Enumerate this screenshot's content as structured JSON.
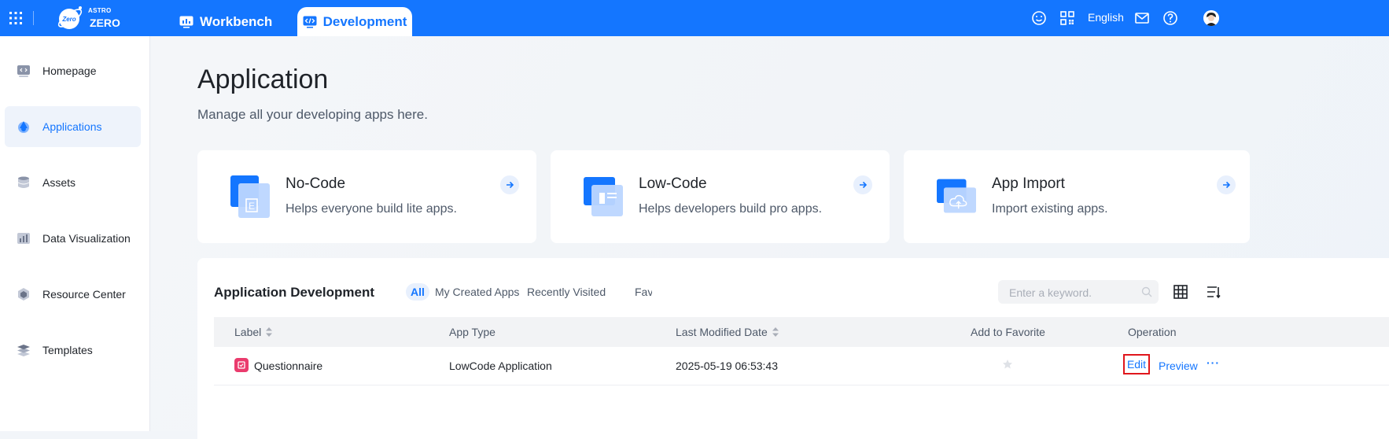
{
  "brand": {
    "line1": "ASTRO",
    "line2": "ZERO",
    "badge": "Zero"
  },
  "topbar": {
    "tabs": [
      {
        "label": "Workbench"
      },
      {
        "label": "Development"
      }
    ],
    "language": "English",
    "accent": "#1476ff"
  },
  "sidebar": {
    "items": [
      {
        "label": "Homepage",
        "icon": "code-page-icon"
      },
      {
        "label": "Applications",
        "icon": "applications-icon",
        "active": true
      },
      {
        "label": "Assets",
        "icon": "assets-icon"
      },
      {
        "label": "Data Visualization",
        "icon": "chart-icon"
      },
      {
        "label": "Resource Center",
        "icon": "resource-icon"
      },
      {
        "label": "Templates",
        "icon": "templates-icon"
      }
    ]
  },
  "page": {
    "title": "Application",
    "subtitle": "Manage all your developing apps here."
  },
  "cards": [
    {
      "title": "No-Code",
      "desc": "Helps everyone build lite apps."
    },
    {
      "title": "Low-Code",
      "desc": "Helps developers build pro apps."
    },
    {
      "title": "App Import",
      "desc": "Import existing apps."
    }
  ],
  "panel": {
    "title": "Application Development",
    "filters": [
      "All",
      "My Created Apps",
      "Recently Visited",
      "Favorites"
    ],
    "search_placeholder": "Enter a keyword.",
    "columns": [
      "Label",
      "App Type",
      "Last Modified Date",
      "Add to Favorite",
      "Operation"
    ],
    "rows": [
      {
        "label": "Questionnaire",
        "app_type": "LowCode Application",
        "modified": "2025-05-19 06:53:43",
        "favorite": false,
        "actions": [
          "Edit",
          "Preview",
          "···"
        ]
      }
    ]
  }
}
